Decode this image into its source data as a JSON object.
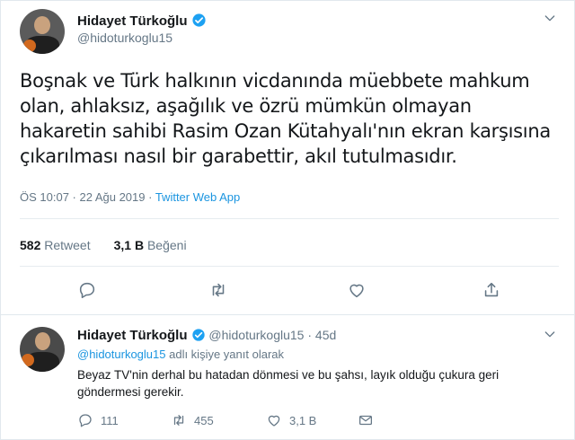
{
  "main_tweet": {
    "author_name": "Hidayet Türkoğlu",
    "author_handle": "@hidoturkoglu15",
    "text": "Boşnak ve Türk halkının vicdanında müebbete mahkum olan, ahlaksız, aşağılık ve özrü mümkün olmayan hakaretin sahibi Rasim Ozan Kütahyalı'nın ekran karşısına çıkarılması nasıl bir garabettir, akıl tutulmasıdır.",
    "timestamp": "ÖS 10:07 · 22 Ağu 2019 · ",
    "source": "Twitter Web App",
    "retweet_count": "582",
    "retweet_label": "Retweet",
    "like_count": "3,1 B",
    "like_label": "Beğeni"
  },
  "reply_tweet": {
    "author_name": "Hidayet Türkoğlu",
    "author_handle": "@hidoturkoglu15",
    "age": "· 45d",
    "mention": "@hidoturkoglu15",
    "reply_label": "adlı kişiye yanıt olarak",
    "text": "Beyaz TV'nin derhal bu hatadan dönmesi ve bu şahsı, layık olduğu çukura geri göndermesi gerekir.",
    "reply_count": "111",
    "retweet_count": "455",
    "like_count": "3,1 B"
  },
  "icons": {
    "verified": "verified-badge-icon",
    "chevron": "chevron-down-icon",
    "reply": "reply-icon",
    "retweet": "retweet-icon",
    "like": "heart-icon",
    "share": "share-icon",
    "mail": "mail-icon"
  },
  "colors": {
    "accent": "#1b95e0",
    "text": "#14171a",
    "muted": "#657786",
    "divider": "#e6ecf0"
  }
}
